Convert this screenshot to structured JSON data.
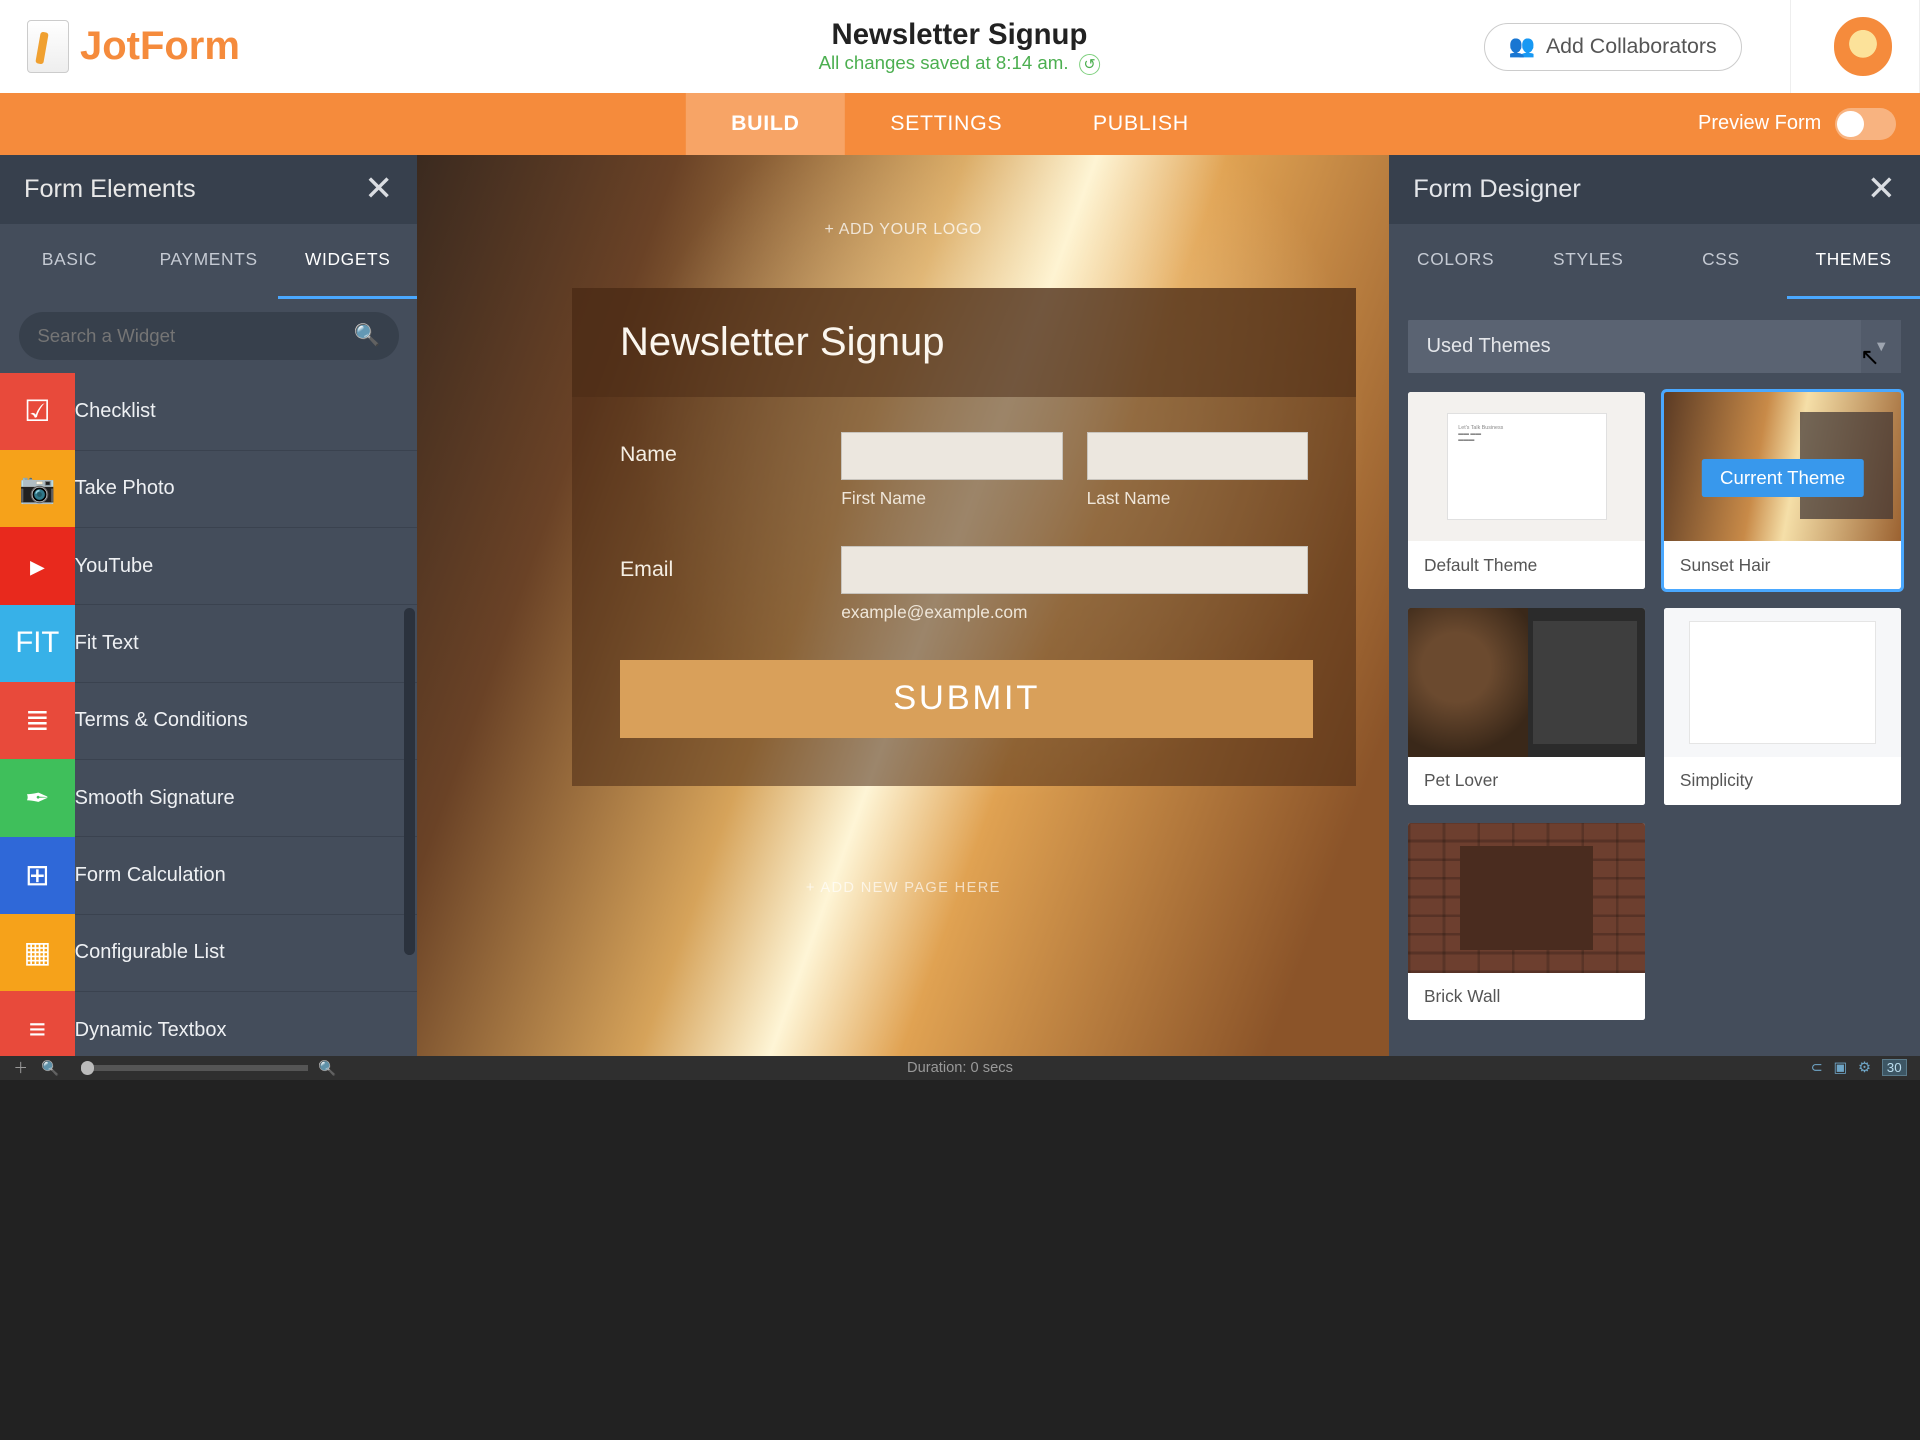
{
  "header": {
    "brand": "JotForm",
    "title": "Newsletter Signup",
    "save_status": "All changes saved at 8:14 am.",
    "collab_label": "Add Collaborators"
  },
  "nav": {
    "tabs": [
      "BUILD",
      "SETTINGS",
      "PUBLISH"
    ],
    "preview_label": "Preview Form"
  },
  "left": {
    "title": "Form Elements",
    "tabs": [
      "BASIC",
      "PAYMENTS",
      "WIDGETS"
    ],
    "search_placeholder": "Search a Widget",
    "widgets": [
      {
        "label": "Checklist",
        "color": "#e84a3b"
      },
      {
        "label": "Take Photo",
        "color": "#f6a21a"
      },
      {
        "label": "YouTube",
        "color": "#e8291d"
      },
      {
        "label": "Fit Text",
        "color": "#37b1e8"
      },
      {
        "label": "Terms & Conditions",
        "color": "#e84a3b"
      },
      {
        "label": "Smooth Signature",
        "color": "#3fbf5b"
      },
      {
        "label": "Form Calculation",
        "color": "#2f68d8"
      },
      {
        "label": "Configurable List",
        "color": "#f6a21a"
      },
      {
        "label": "Dynamic Textbox",
        "color": "#e84a3b"
      }
    ]
  },
  "form": {
    "add_logo": "+ ADD YOUR LOGO",
    "heading": "Newsletter Signup",
    "name_label": "Name",
    "first_sub": "First Name",
    "last_sub": "Last Name",
    "email_label": "Email",
    "email_hint": "example@example.com",
    "submit": "SUBMIT",
    "add_page": "+ ADD NEW PAGE HERE"
  },
  "right": {
    "title": "Form Designer",
    "tabs": [
      "COLORS",
      "STYLES",
      "CSS",
      "THEMES"
    ],
    "section": "Used Themes",
    "current_badge": "Current Theme",
    "themes": [
      {
        "name": "Default Theme"
      },
      {
        "name": "Sunset Hair"
      },
      {
        "name": "Pet Lover"
      },
      {
        "name": "Simplicity"
      },
      {
        "name": "Brick Wall"
      }
    ]
  },
  "footer": {
    "duration": "Duration: 0 secs",
    "frame": "30"
  }
}
